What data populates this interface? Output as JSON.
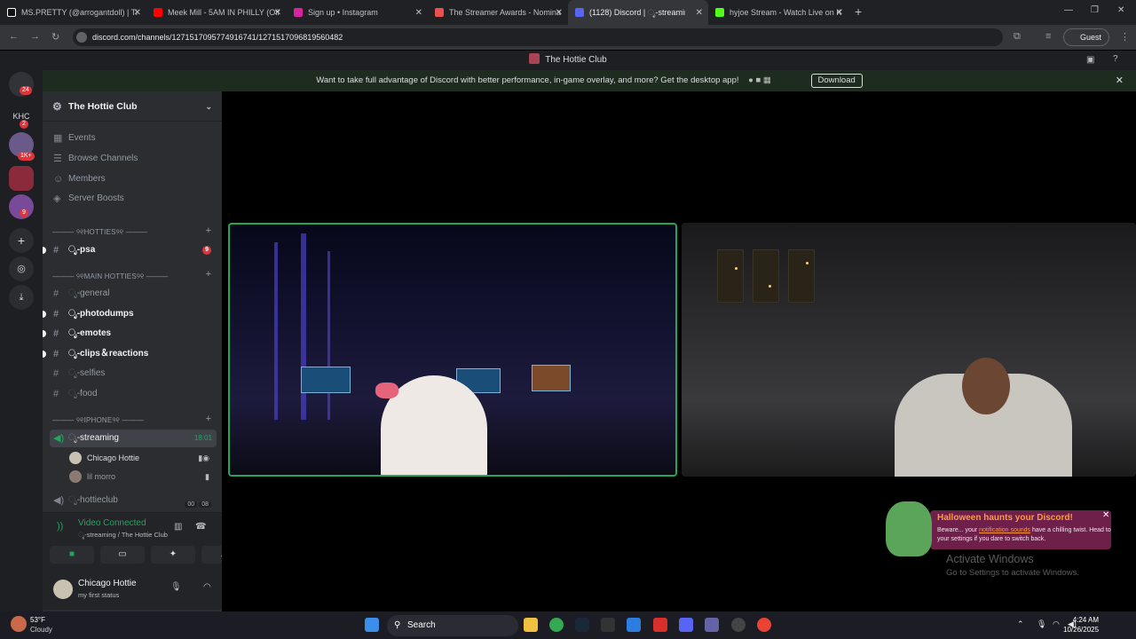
{
  "browser": {
    "tabs": [
      {
        "title": "MS.PRETTY (@arrogantdoll) | Ti",
        "color": "#ffffff"
      },
      {
        "title": "Meek Mill - 5AM IN PHILLY (Offi",
        "color": "#ff0000"
      },
      {
        "title": "Sign up • Instagram",
        "color": "#d6249f"
      },
      {
        "title": "The Streamer Awards - Nominat",
        "color": "#ec4f4f"
      },
      {
        "title": "(1128) Discord | ೃ-streamin",
        "color": "#5865f2",
        "active": true
      },
      {
        "title": "hyjoe Stream - Watch Live on K",
        "color": "#53fc18"
      }
    ],
    "url": "discord.com/channels/1271517095774916741/1271517096819560482",
    "guest_label": "Guest"
  },
  "discord": {
    "title": "The Hottie Club",
    "banner": {
      "text": "Want to take full advantage of Discord with better performance, in-game overlay, and more? Get the desktop app!",
      "download_label": "Download"
    },
    "guild_badges": {
      "dm": "24",
      "khc_label": "KHC",
      "khc": "2",
      "g2": "1K+",
      "g4": "9"
    },
    "server": {
      "name": "The Hottie Club",
      "menu": [
        "Events",
        "Browse Channels",
        "Members",
        "Server Boosts"
      ],
      "categories": [
        {
          "label": "——— ୨୧HOTTIES୨୧ ———"
        },
        {
          "label": "——— ୨୧MAIN HOTTIES୨୧ ———"
        },
        {
          "label": "——— ୨୧IPHONE୨୧ ———"
        }
      ],
      "channels": {
        "psa": {
          "name": "ೃ-psa",
          "badge": "9"
        },
        "general": "ೃ-general",
        "photodumps": "ೃ-photodumps",
        "emotes": "ೃ-emotes",
        "clips": "ೃ-clips＆reactions",
        "selfies": "ೃ-selfies",
        "food": "ೃ-food",
        "streaming": {
          "name": "ೃ-streaming",
          "time": "18:01"
        },
        "hottieclub": {
          "name": "ೃ-hottieclub",
          "count_a": "00",
          "count_b": "08"
        }
      },
      "voice_users": [
        "Chicago Hottie",
        "lil morro"
      ]
    },
    "voice_panel": {
      "status": "Video Connected",
      "location": "ೃ-streaming / The Hottie Club"
    },
    "user": {
      "name": "Chicago Hottie",
      "status": "my first status"
    },
    "toast": {
      "title": "Halloween haunts your Discord!",
      "line_a": "Beware... your ",
      "link": "notification sounds",
      "line_b": " have a chilling twist. Head to your settings if you dare to switch back."
    }
  },
  "windows": {
    "activate_title": "Activate Windows",
    "activate_sub": "Go to Settings to activate Windows.",
    "weather_temp": "53°F",
    "weather_cond": "Cloudy",
    "search_label": "Search",
    "time": "4:24 AM",
    "date": "10/26/2025"
  }
}
